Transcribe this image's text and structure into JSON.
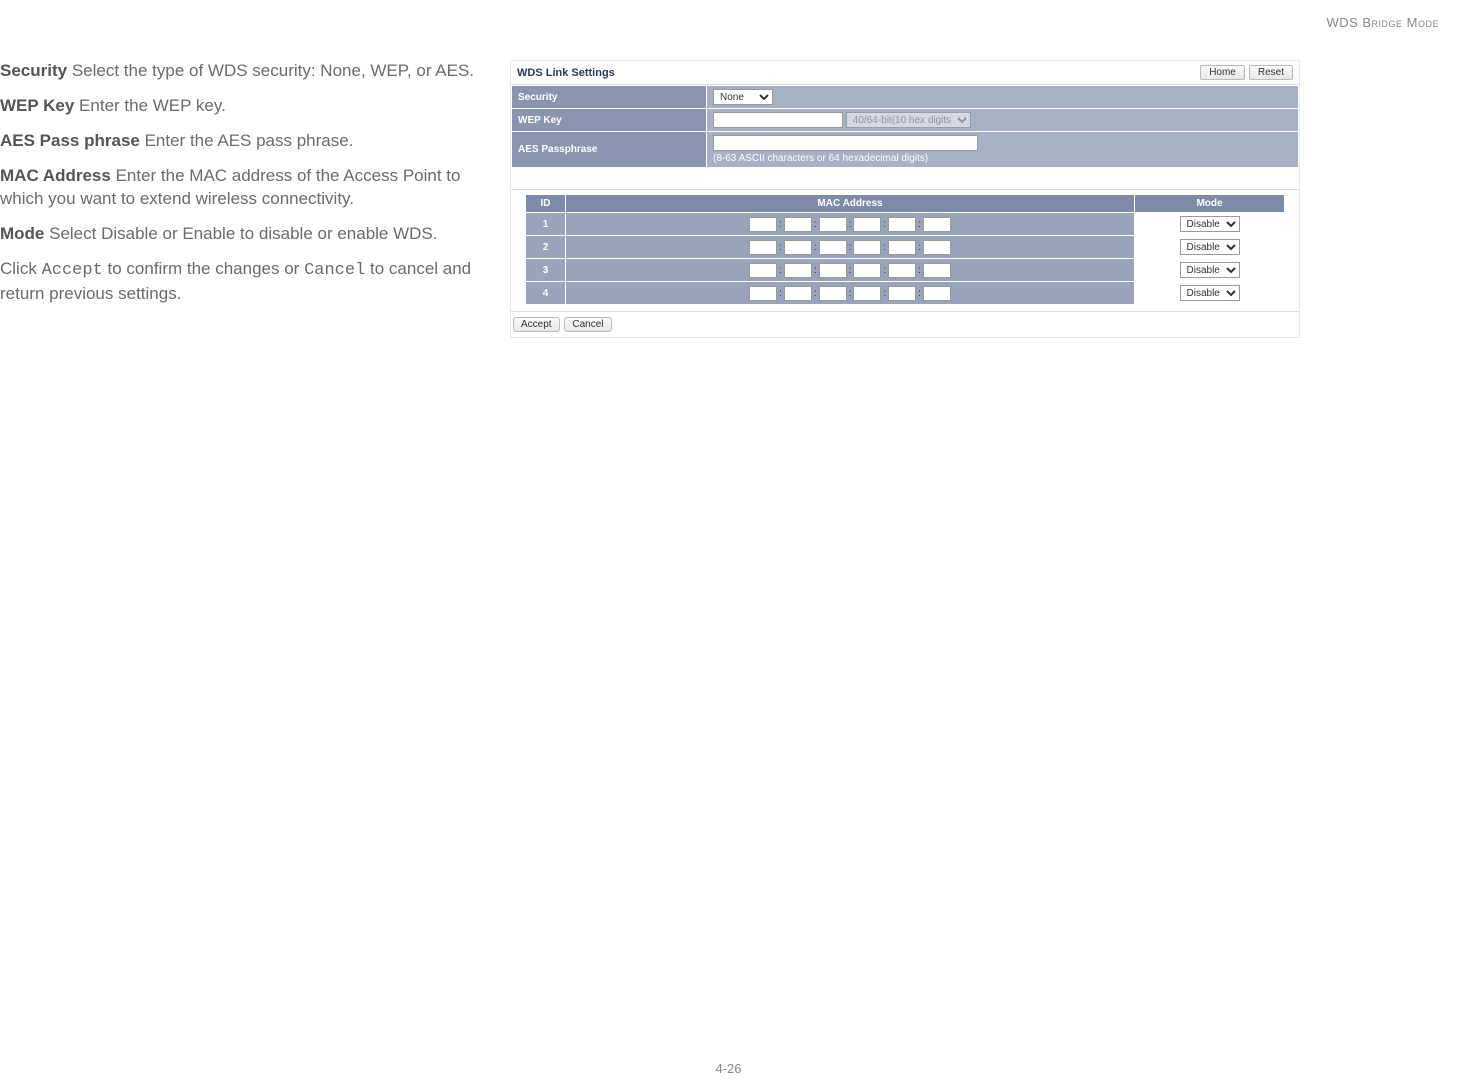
{
  "header": {
    "title": "WDS Bridge Mode"
  },
  "desc": {
    "security_label": "Security",
    "security_text": "  Select the type of WDS security: None, WEP, or AES.",
    "wepkey_label": "WEP Key",
    "wepkey_text": "  Enter the WEP key.",
    "aes_label": "AES Pass phrase",
    "aes_text": "  Enter the AES pass phrase.",
    "mac_label": "MAC Address",
    "mac_text": "  Enter the MAC address of the Access Point to which you want to extend wireless connectivity.",
    "mode_label": "Mode",
    "mode_text": "  Select Disable or Enable to disable or enable WDS.",
    "click1": "Click ",
    "accept": "Accept",
    "click2": " to confirm the changes or ",
    "cancel": "Cancel",
    "click3": " to cancel and return previous settings."
  },
  "panel": {
    "title": "WDS Link Settings",
    "home": "Home",
    "reset": "Reset",
    "labels": {
      "security": "Security",
      "wepkey": "WEP Key",
      "aes": "AES Passphrase"
    },
    "security_value": "None",
    "wep_option": "40/64-bit(10 hex digits)",
    "aes_hint": "(8-63 ASCII characters or 64 hexadecimal digits)"
  },
  "mac": {
    "headers": {
      "id": "ID",
      "mac": "MAC Address",
      "mode": "Mode"
    },
    "rows": [
      {
        "id": "1",
        "mode": "Disable"
      },
      {
        "id": "2",
        "mode": "Disable"
      },
      {
        "id": "3",
        "mode": "Disable"
      },
      {
        "id": "4",
        "mode": "Disable"
      }
    ]
  },
  "footer": {
    "accept": "Accept",
    "cancel": "Cancel"
  },
  "page": "4-26"
}
